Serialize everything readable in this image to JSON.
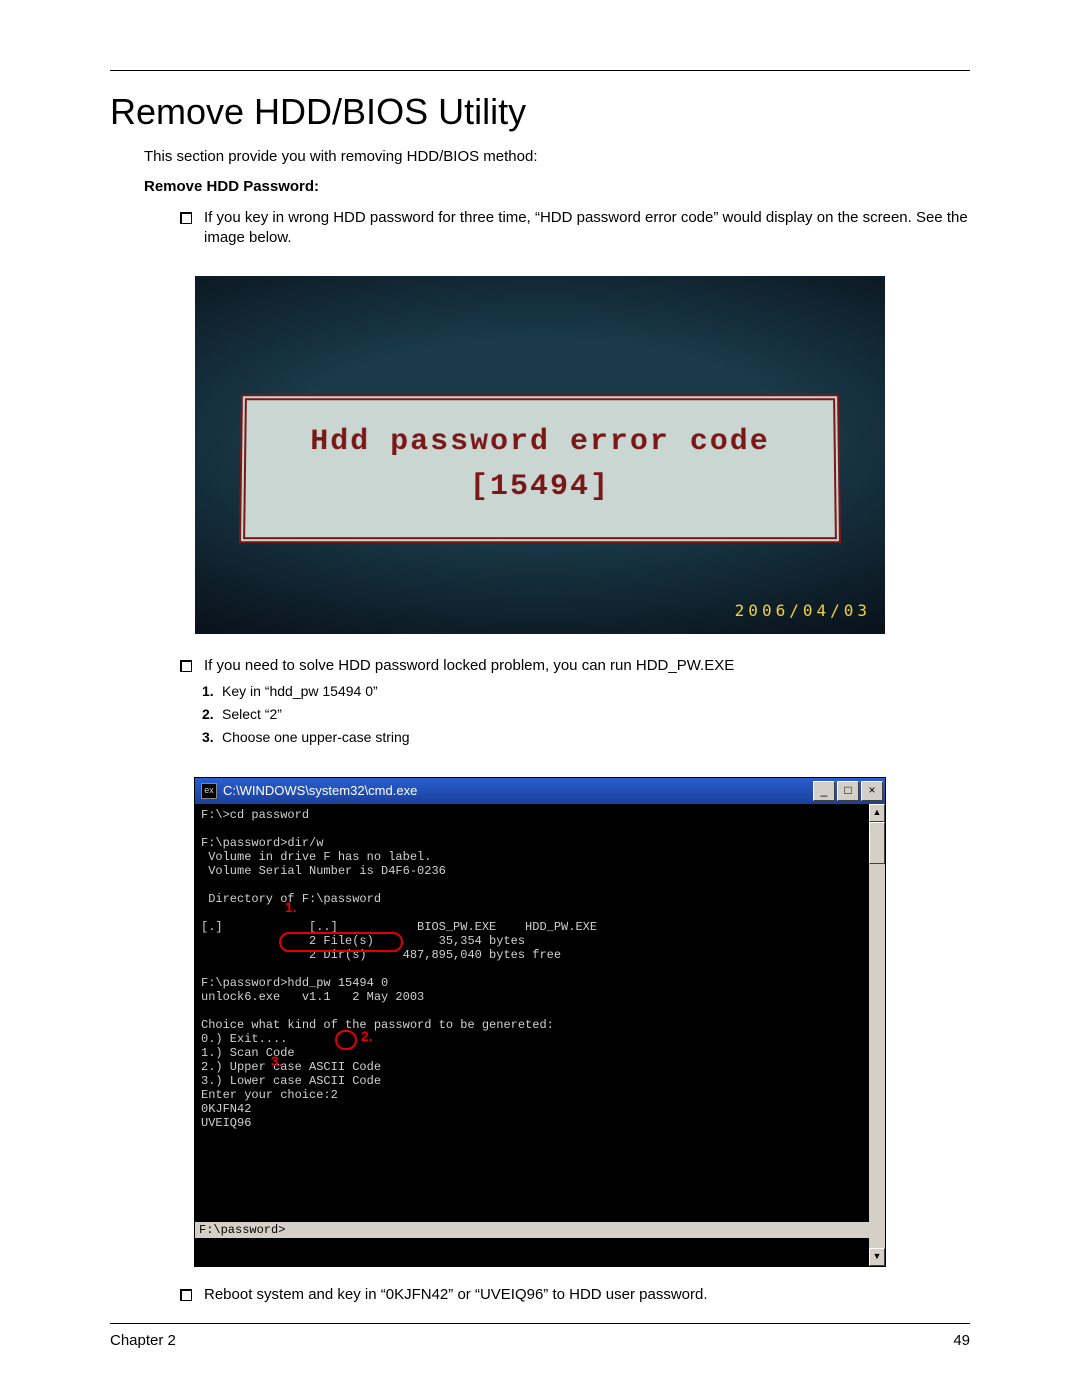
{
  "title": "Remove HDD/BIOS Utility",
  "intro": "This section provide you with removing HDD/BIOS method:",
  "subhead": "Remove HDD Password:",
  "bullets": {
    "b1": "If you key in wrong HDD password for three time, “HDD password error code” would display on the screen. See the image below.",
    "b2": "If you need to solve HDD password locked problem, you can run HDD_PW.EXE",
    "b3": "Reboot system and key in “0KJFN42” or “UVEIQ96” to HDD user password."
  },
  "steps": {
    "n1": "1.",
    "t1": "Key in “hdd_pw 15494 0”",
    "n2": "2.",
    "t2": "Select “2”",
    "n3": "3.",
    "t3": "Choose one upper-case string"
  },
  "photo1": {
    "line1": "Hdd password error code",
    "line2": "[15494]",
    "date": "2006/04/03"
  },
  "cmd": {
    "title_prefix": "ex",
    "title": "C:\\WINDOWS\\system32\\cmd.exe",
    "body": "F:\\>cd password\n\nF:\\password>dir/w\n Volume in drive F has no label.\n Volume Serial Number is D4F6-0236\n\n Directory of F:\\password\n\n[.]            [..]           BIOS_PW.EXE    HDD_PW.EXE\n               2 File(s)         35,354 bytes\n               2 Dir(s)     487,895,040 bytes free\n\nF:\\password>hdd_pw 15494 0\nunlock6.exe   v1.1   2 May 2003\n\nChoice what kind of the password to be genereted:\n0.) Exit....\n1.) Scan Code\n2.) Upper case ASCII Code\n3.) Lower case ASCII Code\nEnter your choice:2\n0KJFN42\nUVEIQ96",
    "status": "F:\\password>",
    "ann1": "1.",
    "ann2": "2.",
    "ann3": "3."
  },
  "footer": {
    "left": "Chapter 2",
    "right": "49"
  }
}
